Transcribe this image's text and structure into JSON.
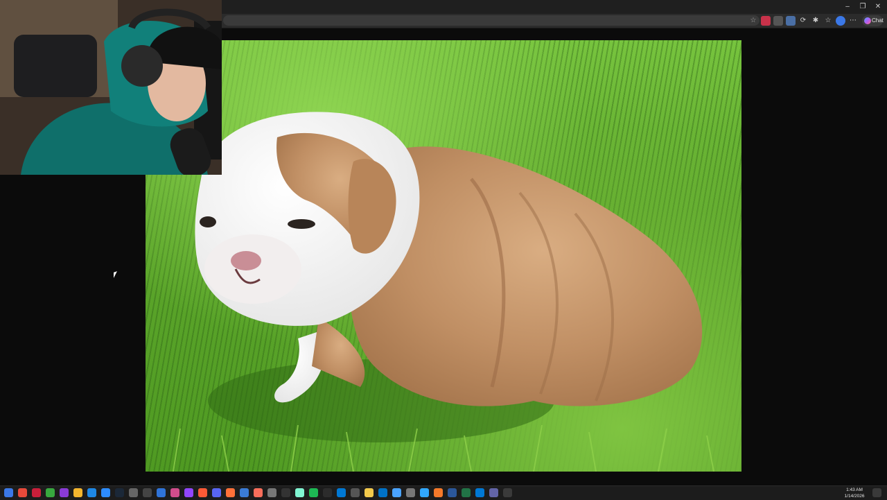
{
  "browser": {
    "chat_label": "Chat",
    "window_controls": {
      "minimize": "–",
      "restore": "❐",
      "close": "✕"
    }
  },
  "taskbar": {
    "time": "1:43 AM",
    "date": "1/14/2026",
    "icons": [
      "windows-start",
      "chrome",
      "opera",
      "xbox",
      "tor",
      "folder",
      "edge",
      "zoom",
      "steam-like",
      "zed",
      "settings",
      "docs",
      "photos",
      "twitch",
      "media",
      "discord",
      "firefox",
      "monitor",
      "arc",
      "notion",
      "obs",
      "streamlabs",
      "spotify",
      "terminal",
      "store",
      "calculator",
      "notes",
      "mail",
      "cloud",
      "camera",
      "photoshop",
      "blender",
      "word",
      "excel",
      "outlook",
      "teams",
      "security"
    ]
  },
  "colors": {
    "browser_frame": "#1f1f1f",
    "toolbar": "#2b2b2b",
    "page_bg": "#0b0b0b",
    "grass": "#5ea82c",
    "taskbar": "#1c1c1c"
  }
}
